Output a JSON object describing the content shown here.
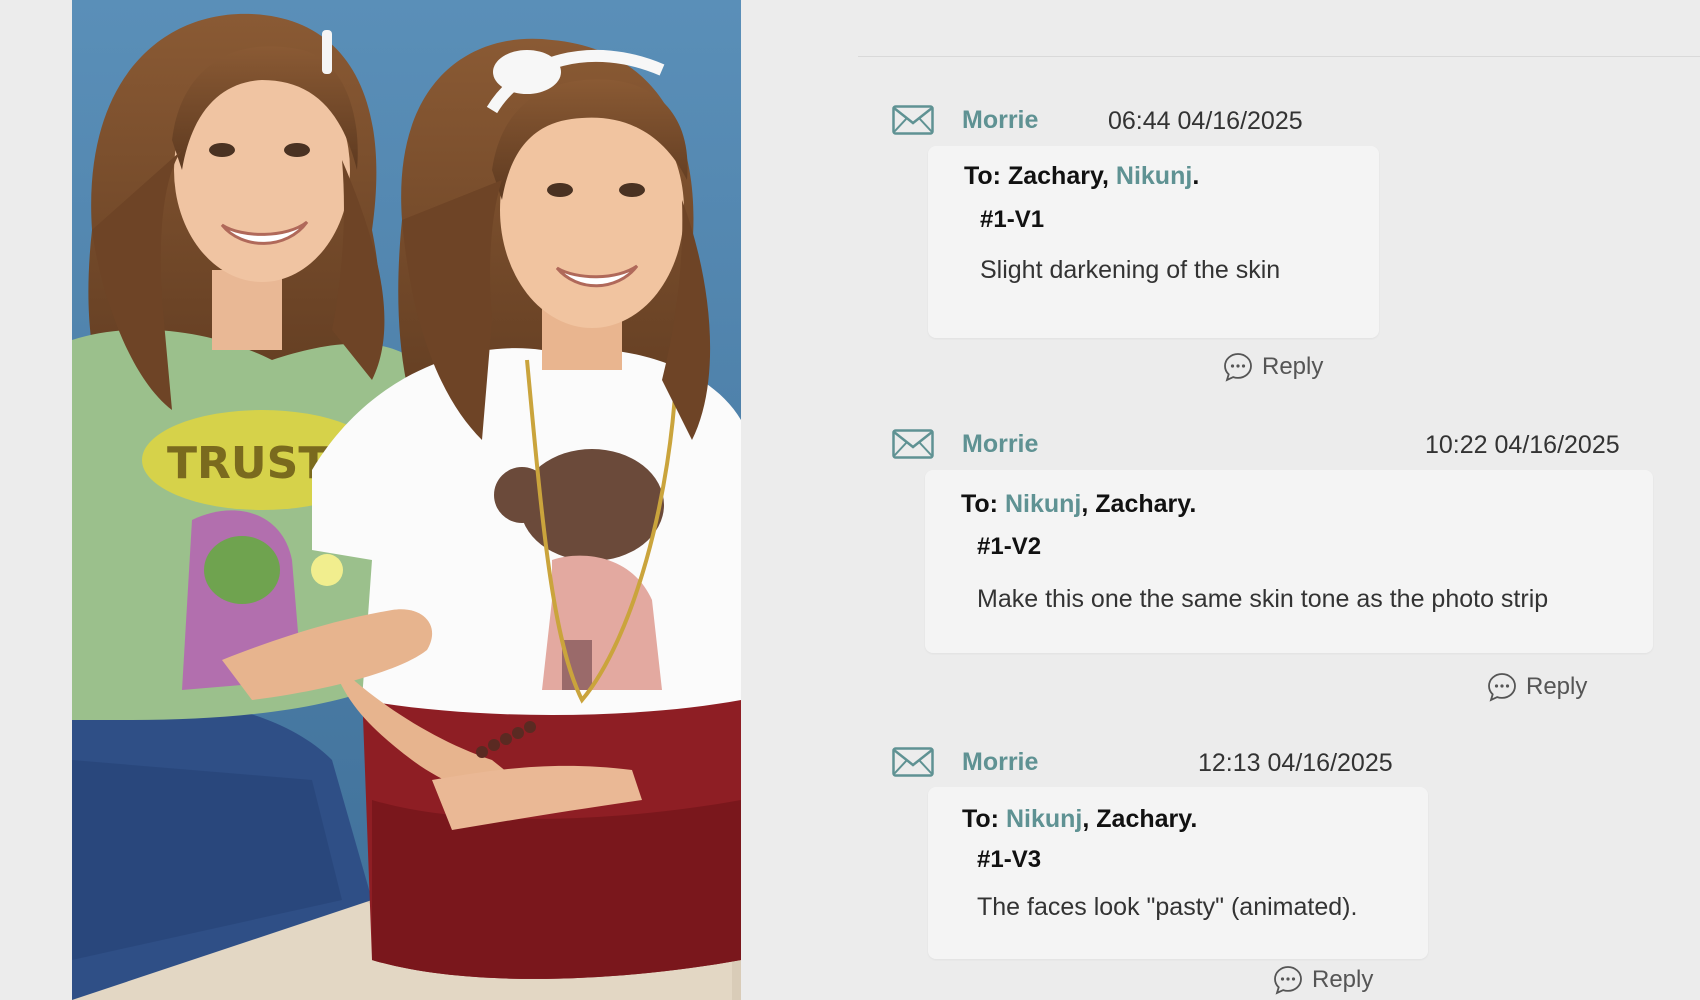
{
  "comments": [
    {
      "author": "Morrie",
      "time": "06:44 04/16/2025",
      "to_prefix": "To: ",
      "recipient_1": "Zachary",
      "separator": ", ",
      "recipient_2": "Nikunj",
      "suffix": ".",
      "version": "#1-V1",
      "body": "Slight darkening of the skin",
      "reply_label": "Reply"
    },
    {
      "author": "Morrie",
      "time": "10:22 04/16/2025",
      "to_prefix": "To: ",
      "recipient_1": "Nikunj",
      "separator": ", ",
      "recipient_2": "Zachary",
      "suffix": ".",
      "version": "#1-V2",
      "body": "Make this one the same skin tone as the photo strip",
      "reply_label": "Reply"
    },
    {
      "author": "Morrie",
      "time": "12:13 04/16/2025",
      "to_prefix": "To: ",
      "recipient_1": "Nikunj",
      "separator": ", ",
      "recipient_2": "Zachary",
      "suffix": ".",
      "version": "#1-V3",
      "body": "The faces look \"pasty\" (animated).",
      "reply_label": "Reply"
    }
  ],
  "photo": {
    "shirt_text": "TRUST ME"
  },
  "icons": {
    "message": "envelope-icon",
    "reply": "chat-bubble-icon"
  },
  "colors": {
    "accent": "#5f9293",
    "background": "#ececec",
    "card": "#f4f4f4"
  }
}
